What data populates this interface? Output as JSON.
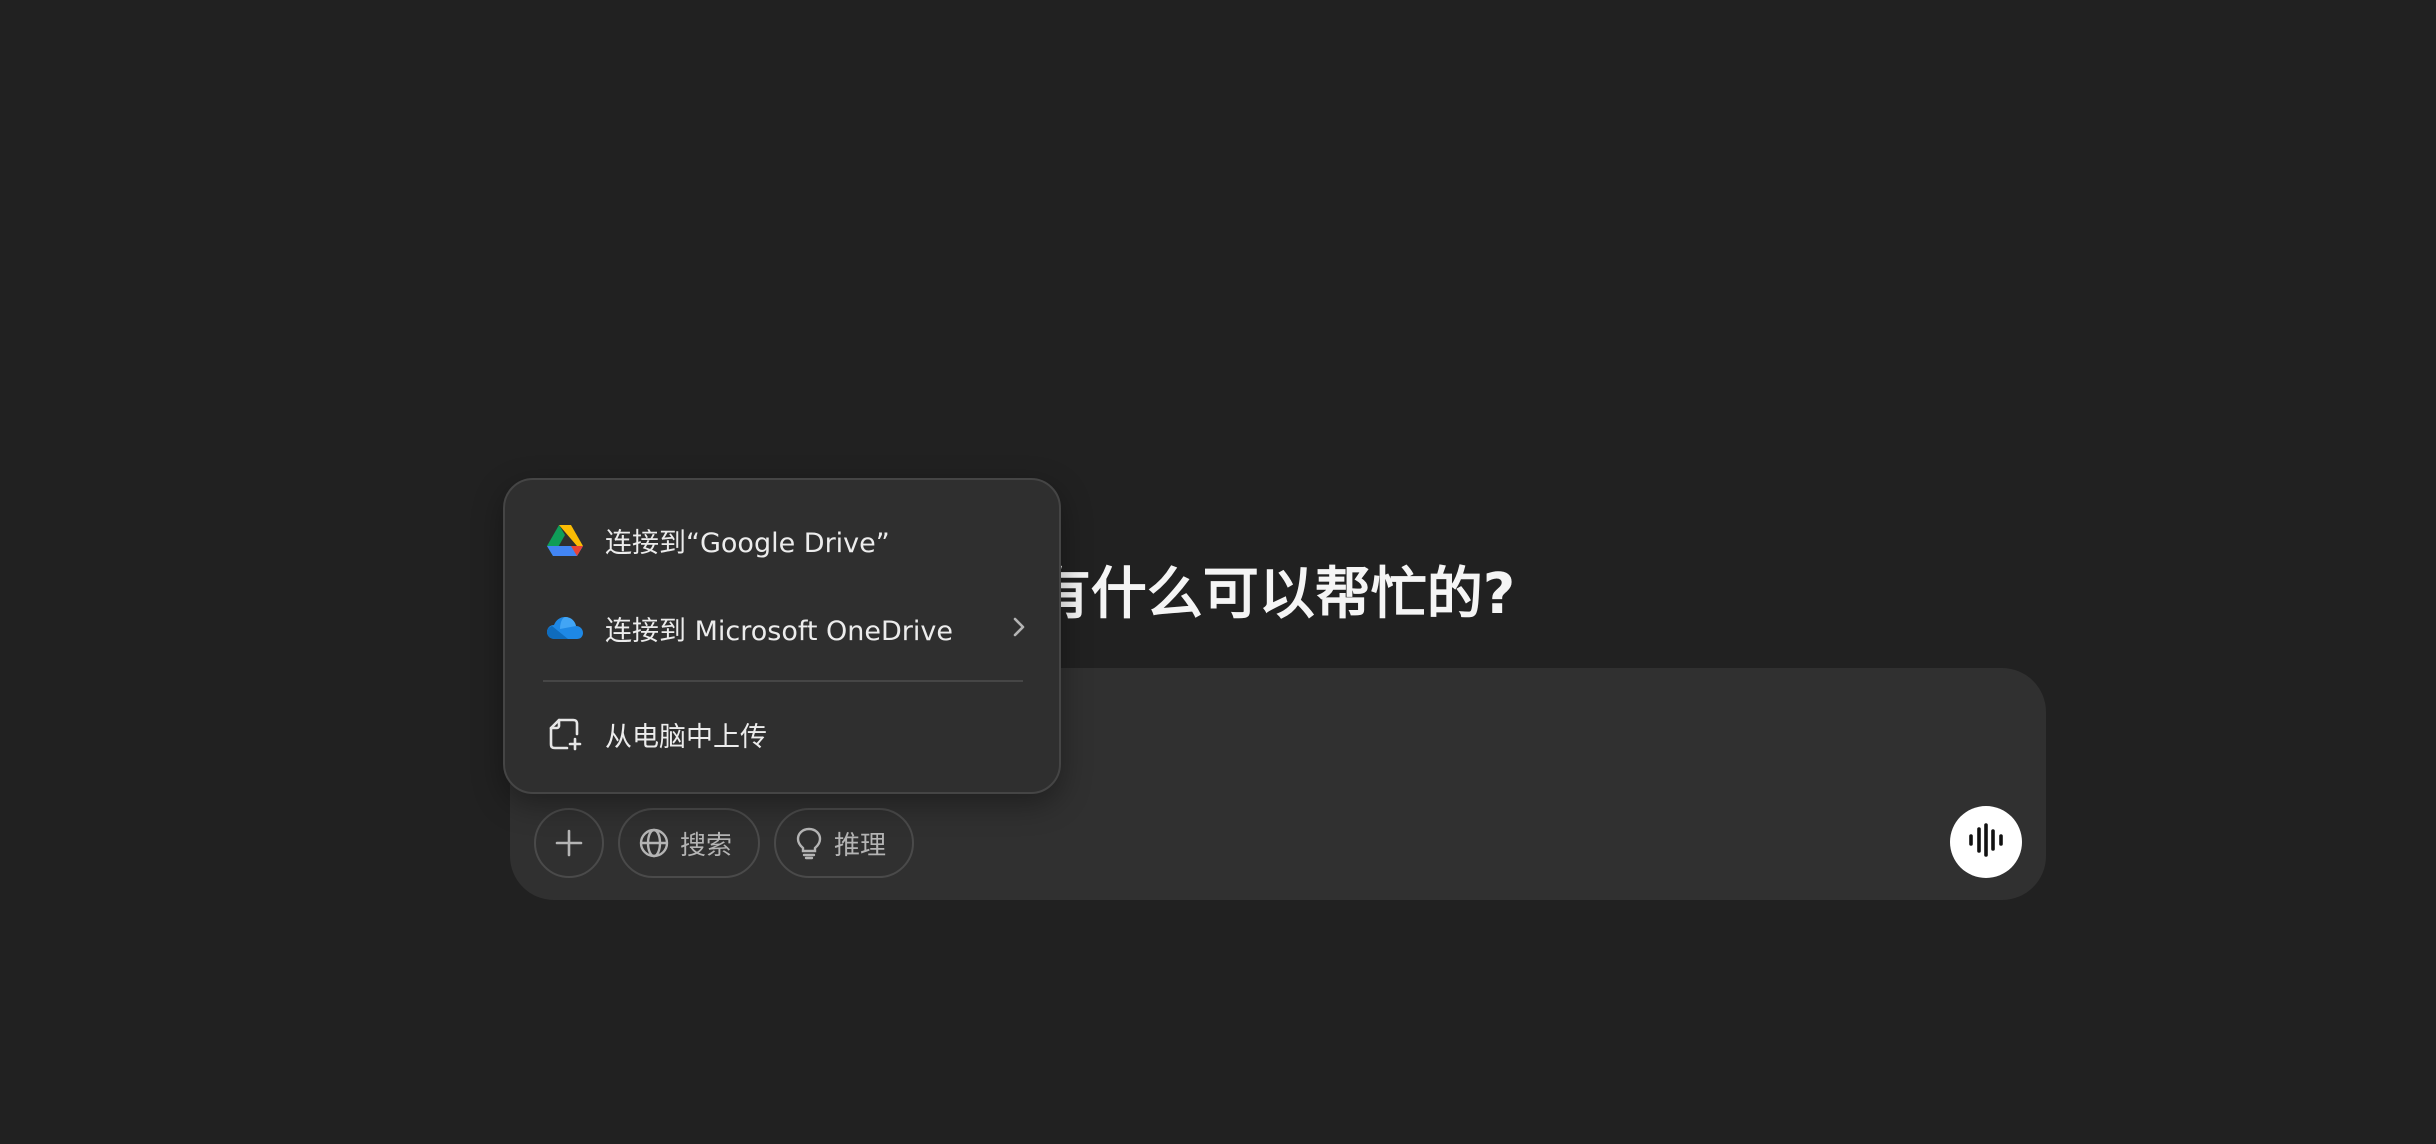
{
  "heading": "有什么可以帮忙的?",
  "composer": {
    "placeholder": "",
    "toolbar": {
      "add_icon": "plus-icon",
      "search_label": "搜索",
      "reason_label": "推理"
    },
    "voice_icon": "voice-waveform-icon"
  },
  "attach_menu": {
    "items": [
      {
        "label": "连接到“Google Drive”",
        "icon": "google-drive-icon"
      },
      {
        "label": "连接到 Microsoft OneDrive",
        "icon": "onedrive-icon",
        "has_submenu": true
      },
      {
        "label": "从电脑中上传",
        "icon": "upload-file-icon"
      }
    ]
  },
  "colors": {
    "background": "#212121",
    "composer": "#303030",
    "menu": "#2f2f2f",
    "text": "#ececec",
    "voice_button": "#ffffff"
  }
}
